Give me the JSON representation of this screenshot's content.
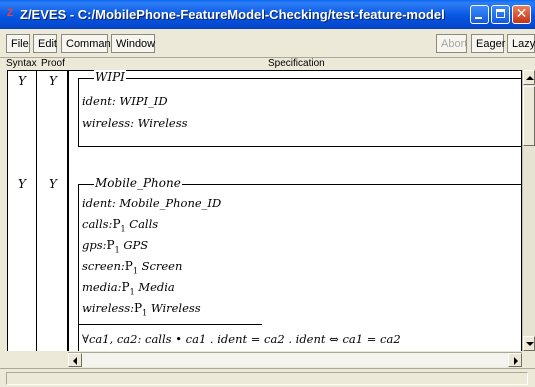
{
  "window": {
    "app_icon": "zeves-app-icon",
    "app_icon_glyph": "Z",
    "title": "Z/EVES - C:/MobilePhone-FeatureModel-Checking/test-feature-model",
    "controls": {
      "minimize": "minimize-icon",
      "maximize": "maximize-icon",
      "close": "close-icon"
    }
  },
  "menubar": {
    "items": [
      {
        "label": "File"
      },
      {
        "label": "Edit"
      },
      {
        "label": "Command"
      },
      {
        "label": "Window"
      }
    ],
    "right_buttons": [
      {
        "label": "Abort",
        "enabled": false
      },
      {
        "label": "Eager",
        "enabled": true
      },
      {
        "label": "Lazy",
        "enabled": true
      }
    ]
  },
  "columns": {
    "syntax": "Syntax",
    "proof": "Proof",
    "specification": "Specification"
  },
  "paragraphs": [
    {
      "syntax": "Y",
      "proof": "Y",
      "schema_name": "WIPI",
      "declarations": [
        "ident: WIPI_ID",
        "wireless: Wireless"
      ]
    },
    {
      "syntax": "Y",
      "proof": "Y",
      "schema_name": "Mobile_Phone",
      "declarations": [
        {
          "name": "ident:",
          "type": "Mobile_Phone_ID"
        },
        {
          "name": "calls:",
          "power": "P",
          "power_sub": "1",
          "type": "Calls"
        },
        {
          "name": "gps:",
          "power": "P",
          "power_sub": "1",
          "type": "GPS"
        },
        {
          "name": "screen:",
          "power": "P",
          "power_sub": "1",
          "type": "Screen"
        },
        {
          "name": "media:",
          "power": "P",
          "power_sub": "1",
          "type": "Media"
        },
        {
          "name": "wireless:",
          "power": "P",
          "power_sub": "1",
          "type": "Wireless"
        }
      ],
      "predicate": "∀ca1, ca2: calls • ca1 . ident = ca2 . ident ⇔ ca1 = ca2"
    }
  ],
  "scrollbars": {
    "vertical": {
      "up": "scroll-up-arrow-icon",
      "down": "scroll-down-arrow-icon"
    },
    "horizontal": {
      "left": "scroll-left-arrow-icon",
      "right": "scroll-right-arrow-icon"
    }
  },
  "status_text": ""
}
